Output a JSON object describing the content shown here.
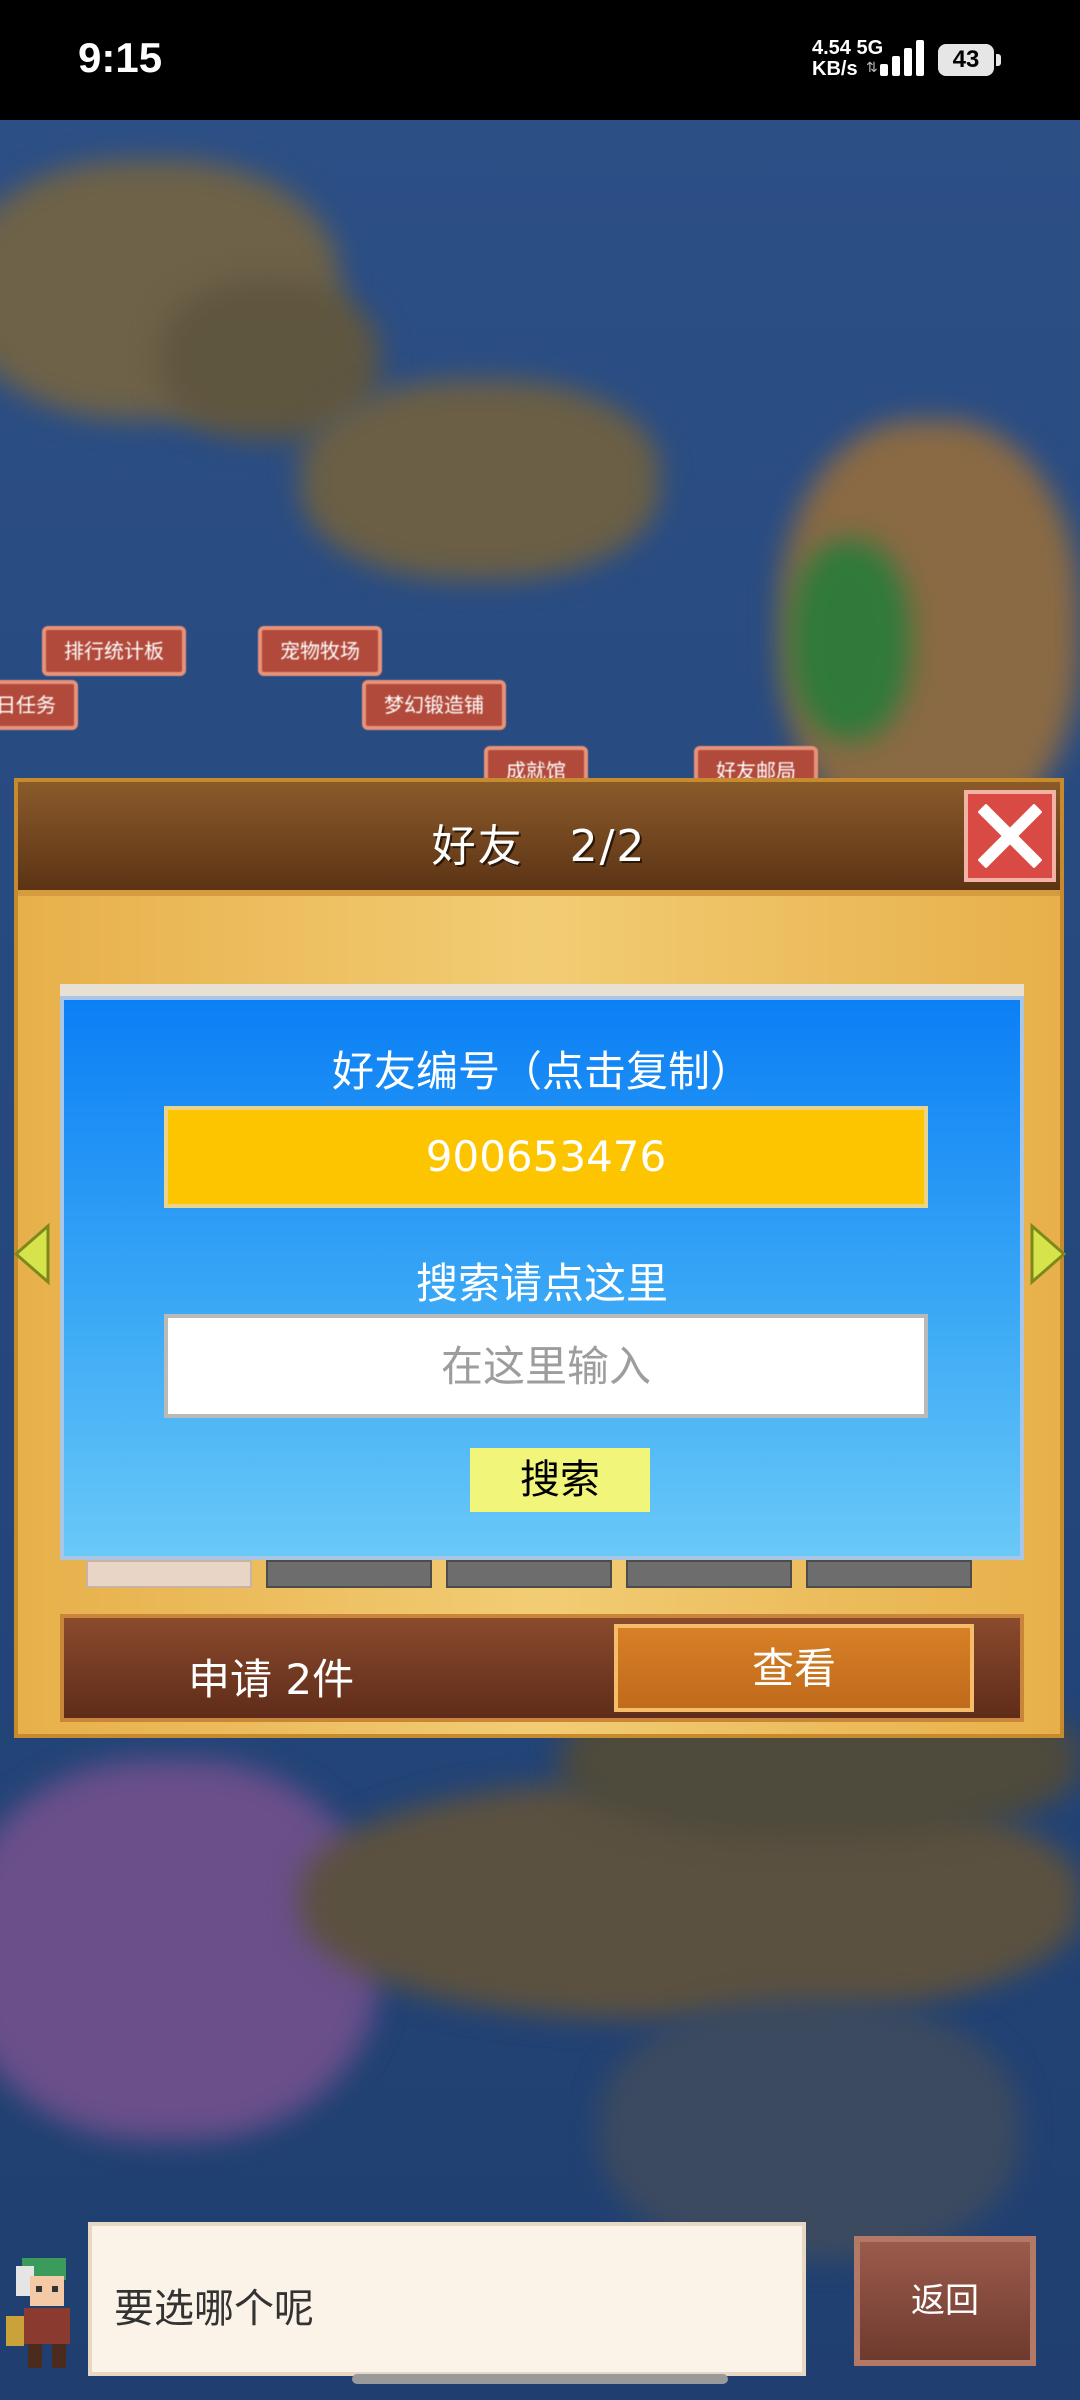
{
  "status_bar": {
    "time": "9:15",
    "net_speed": "4.54",
    "net_unit": "KB/s",
    "network_type": "5G",
    "battery": "43"
  },
  "map": {
    "labels": [
      "排行统计板",
      "宠物牧场",
      "日任务",
      "梦幻锻造铺",
      "成就馆",
      "好友邮局"
    ]
  },
  "dialog": {
    "title": "好友　2/2",
    "close_icon": "close-x-icon",
    "friend_id_label": "好友编号（点击复制）",
    "friend_id_value": "900653476",
    "search_hint": "搜索请点这里",
    "search_placeholder": "在这里输入",
    "search_button": "搜索",
    "request_count": "申请 2件",
    "view_button": "查看"
  },
  "bottom": {
    "speech_text": "要选哪个呢",
    "back_button": "返回"
  },
  "colors": {
    "panel_blue": "#0b7ff5",
    "id_yellow": "#fdc500",
    "close_red": "#d94a45",
    "view_orange": "#d88026"
  }
}
